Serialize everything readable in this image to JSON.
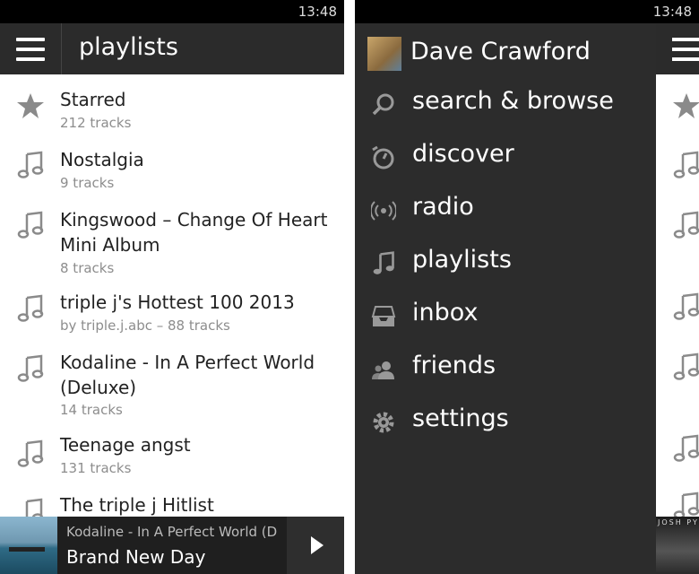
{
  "status": {
    "time": "13:48"
  },
  "left": {
    "title": "playlists",
    "items": [
      {
        "name": "Starred",
        "sub": "212 tracks",
        "icon": "star-icon"
      },
      {
        "name": "Nostalgia",
        "sub": "9 tracks",
        "icon": "music-note-icon"
      },
      {
        "name": "Kingswood – Change Of Heart Mini Album",
        "sub": "8 tracks",
        "icon": "music-note-icon"
      },
      {
        "name": "triple j's Hottest 100 2013",
        "sub": "by triple.j.abc – 88 tracks",
        "icon": "music-note-icon"
      },
      {
        "name": "Kodaline - In A Perfect World (Deluxe)",
        "sub": "14 tracks",
        "icon": "music-note-icon"
      },
      {
        "name": "Teenage angst",
        "sub": "131 tracks",
        "icon": "music-note-icon"
      },
      {
        "name": "The triple j Hitlist",
        "sub": "",
        "icon": "music-note-icon"
      }
    ],
    "player": {
      "line1": "Kodaline - In A Perfect World (De",
      "line2": "Brand New Day"
    }
  },
  "drawer": {
    "user": "Dave Crawford",
    "menu": [
      {
        "label": "search & browse",
        "icon": "search-icon"
      },
      {
        "label": "discover",
        "icon": "discover-icon"
      },
      {
        "label": "radio",
        "icon": "radio-icon"
      },
      {
        "label": "playlists",
        "icon": "music-note-icon"
      },
      {
        "label": "inbox",
        "icon": "inbox-icon"
      },
      {
        "label": "friends",
        "icon": "friends-icon"
      },
      {
        "label": "settings",
        "icon": "gear-icon"
      }
    ],
    "peek_album_text": "JOSH PY"
  },
  "colors": {
    "appbar": "#2b2b2b",
    "drawer": "#2c2c2c",
    "icon_gray": "#8a8a8a"
  }
}
